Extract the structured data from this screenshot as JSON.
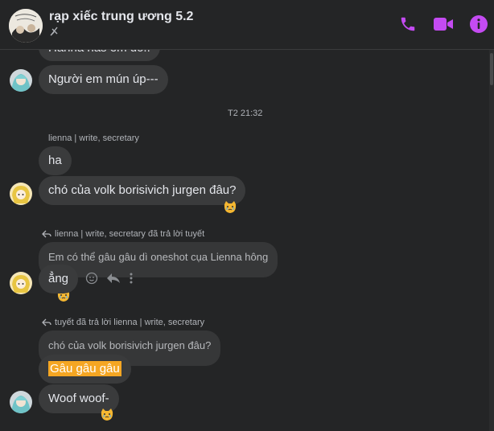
{
  "header": {
    "title": "rạp xiếc trung ương 5.2",
    "accent_color": "#c44bf2"
  },
  "messages": {
    "m0_text": "Hahha has em đó..",
    "m1_text": "Người em mún úp---",
    "timestamp": "T2 21:32",
    "sender_lienna": "lienna | write, secretary",
    "m2_text": "ha",
    "m3_text": "chó của volk borisivich jurgen đâu?",
    "reply1_label": "lienna | write, secretary đã trả lời tuyết",
    "reply1_quote": "Em có thể gâu gâu dì oneshot cụa Lienna hông",
    "m4_text": "ẳng",
    "reply2_label": "tuyết đã trả lời lienna | write, secretary",
    "reply2_quote": "chó của volk borisivich jurgen đâu?",
    "m5_text": "Gâu gâu gâu",
    "m6_text": "Woof woof-"
  }
}
